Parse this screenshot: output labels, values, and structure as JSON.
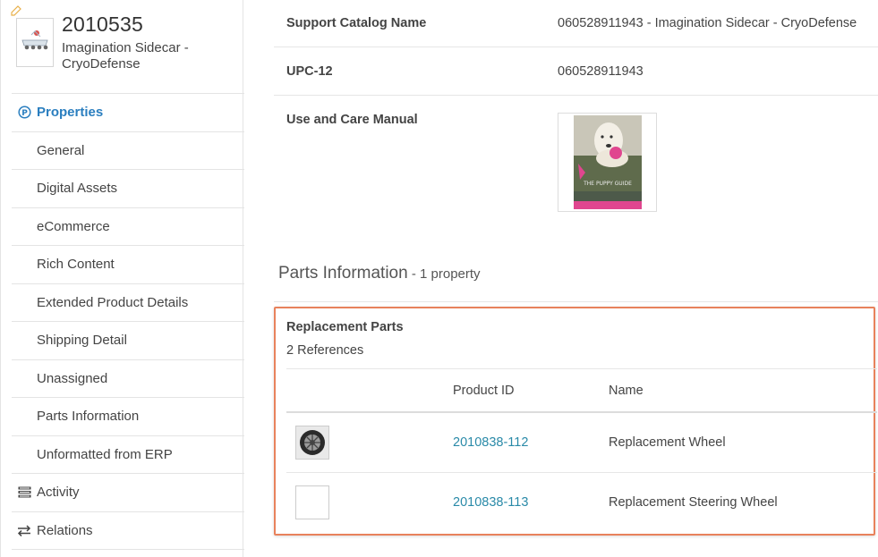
{
  "product": {
    "id": "2010535",
    "name": "Imagination Sidecar - CryoDefense"
  },
  "sidebar": {
    "items": [
      {
        "label": "Properties",
        "type": "section",
        "active": true,
        "icon": "properties-circle-p-icon"
      },
      {
        "label": "General",
        "type": "sub"
      },
      {
        "label": "Digital Assets",
        "type": "sub"
      },
      {
        "label": "eCommerce",
        "type": "sub"
      },
      {
        "label": "Rich Content",
        "type": "sub"
      },
      {
        "label": "Extended Product Details",
        "type": "sub"
      },
      {
        "label": "Shipping Detail",
        "type": "sub"
      },
      {
        "label": "Unassigned",
        "type": "sub"
      },
      {
        "label": "Parts Information",
        "type": "sub"
      },
      {
        "label": "Unformatted from ERP",
        "type": "sub"
      },
      {
        "label": "Activity",
        "type": "section",
        "icon": "activity-list-icon"
      },
      {
        "label": "Relations",
        "type": "section",
        "icon": "relations-arrows-icon"
      }
    ]
  },
  "properties": {
    "support_catalog_name": {
      "label": "Support Catalog Name",
      "value": "060528911943 - Imagination Sidecar - CryoDefense"
    },
    "upc12": {
      "label": "UPC-12",
      "value": "060528911943"
    },
    "manual": {
      "label": "Use and Care Manual",
      "thumb_caption": "THE PUPPY GUIDE"
    }
  },
  "parts_section": {
    "title": "Parts Information",
    "count": " - 1 property"
  },
  "replacement_parts": {
    "title": "Replacement Parts",
    "references": "2 References",
    "columns": {
      "product_id": "Product ID",
      "name": "Name"
    },
    "rows": [
      {
        "product_id": "2010838-112",
        "name": "Replacement Wheel",
        "thumb": "wheel-icon"
      },
      {
        "product_id": "2010838-113",
        "name": "Replacement Steering Wheel",
        "thumb": "empty"
      }
    ]
  },
  "colors": {
    "accent": "#2a7ebf",
    "link": "#2a8aa8",
    "highlight_border": "#e8825c"
  }
}
